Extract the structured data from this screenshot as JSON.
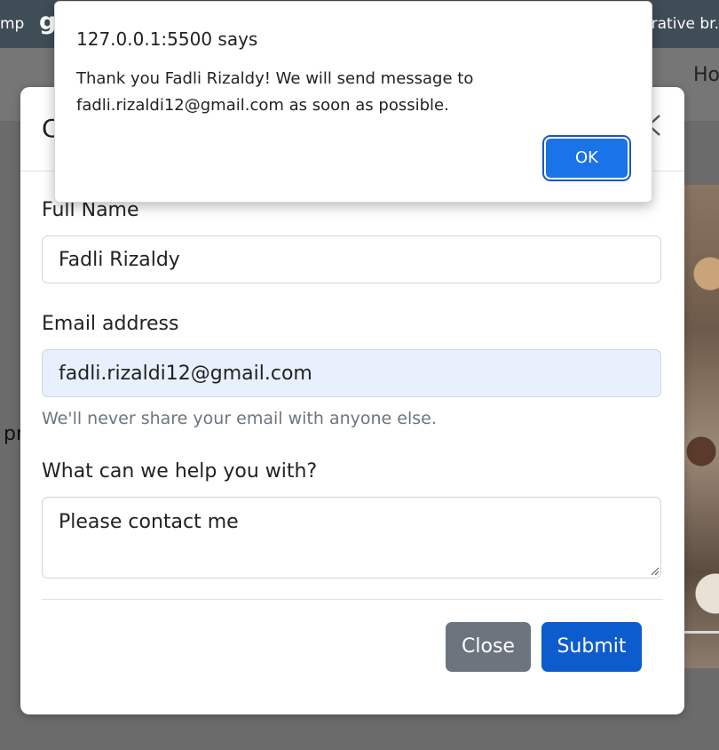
{
  "background": {
    "topbar_left": "mp",
    "topbar_logo": "g",
    "topbar_right": "orative br.",
    "nav_home": "Ho",
    "side_text": "pr"
  },
  "modal": {
    "title_partial": "C",
    "full_name_label": "Full Name",
    "full_name_value": "Fadli Rizaldy",
    "email_label": "Email address",
    "email_value": "fadli.rizaldi12@gmail.com",
    "email_help": "We'll never share your email with anyone else.",
    "message_label": "What can we help you with?",
    "message_value": "Please contact me",
    "close_label": "Close",
    "submit_label": "Submit",
    "close_icon": "close-x-icon"
  },
  "alert": {
    "origin": "127.0.0.1:5500 says",
    "message": "Thank you Fadli Rizaldy! We will send message to fadli.rizaldi12@gmail.com as soon as possible.",
    "ok_label": "OK"
  },
  "colors": {
    "primary": "#0d5cce",
    "secondary": "#6c757d",
    "alert_button": "#1a73e8",
    "autofill_bg": "#e8f0fe"
  }
}
